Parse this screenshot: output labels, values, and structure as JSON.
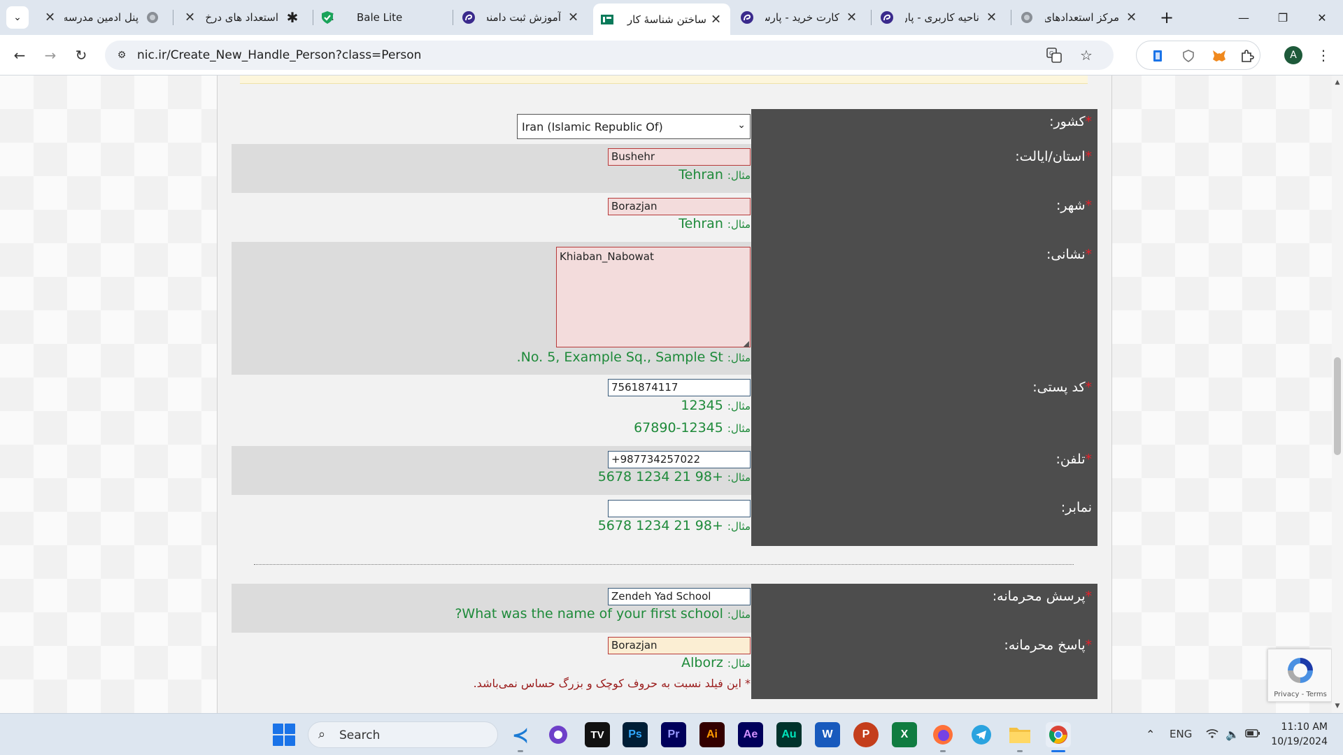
{
  "tabs": [
    {
      "title": "پنل ادمین مدرسه",
      "favicon": "globe-icon"
    },
    {
      "title": "استعداد های درخ",
      "favicon": "asterisk-icon"
    },
    {
      "title": "Bale Lite",
      "favicon": "shield-check-icon"
    },
    {
      "title": "آموزش ثبت دامنه",
      "favicon": "parspack-icon"
    },
    {
      "title": "ساختن شناسهٔ کار",
      "favicon": "irnic-icon"
    },
    {
      "title": "کارت خرید - پارس",
      "favicon": "parspack-icon"
    },
    {
      "title": "ناحیه کاربری - پار",
      "favicon": "parspack-icon"
    },
    {
      "title": "مرکز استعدادهای",
      "favicon": "globe-icon"
    }
  ],
  "active_tab": 4,
  "address_bar": {
    "url": "nic.ir/Create_New_Handle_Person?class=Person"
  },
  "profile_initial": "A",
  "form": {
    "country": {
      "label": "کشور:",
      "value": "Iran (Islamic Republic Of)"
    },
    "province": {
      "label": "استان/ایالت:",
      "value": "Bushehr",
      "example_prefix": "مثال:",
      "example": "Tehran"
    },
    "city": {
      "label": "شهر:",
      "value": "Borazjan",
      "example_prefix": "مثال:",
      "example": "Tehran"
    },
    "address": {
      "label": "نشانی:",
      "value": "Khiaban_Nabowat",
      "example_prefix": "مثال:",
      "example": "No. 5, Example Sq., Sample St."
    },
    "postal_code": {
      "label": "کد پستی:",
      "value": "7561874117",
      "example_prefix": "مثال:",
      "example": "12345",
      "example2": "12345-67890"
    },
    "phone": {
      "label": "تلفن:",
      "value": "+987734257022",
      "example_prefix": "مثال:",
      "example": "+98 21 1234 5678"
    },
    "fax": {
      "label": "نمابر:",
      "value": "",
      "example_prefix": "مثال:",
      "example": "+98 21 1234 5678"
    },
    "security_question": {
      "label": "پرسش محرمانه:",
      "value": "Zendeh Yad School",
      "example_prefix": "مثال:",
      "example": "What was the name of your first school?"
    },
    "security_answer": {
      "label": "پاسخ محرمانه:",
      "value": "Borazjan",
      "example_prefix": "مثال:",
      "example": "Alborz"
    },
    "required_mark": "*",
    "case_note": "* این فیلد نسبت به حروف کوچک و بزرگ حساس نمی‌باشد."
  },
  "recaptcha": {
    "links": "Privacy - Terms"
  },
  "taskbar": {
    "search_label": "Search",
    "apps": [
      "vscode-icon",
      "github-icon",
      "tradingview-icon",
      "photoshop-icon",
      "premiere-icon",
      "illustrator-icon",
      "after-effects-icon",
      "audition-icon",
      "word-icon",
      "powerpoint-icon",
      "excel-icon",
      "firefox-icon",
      "telegram-icon",
      "file-explorer-icon",
      "chrome-icon"
    ],
    "app_labels": {
      "tradingview": "TV",
      "photoshop": "Ps",
      "premiere": "Pr",
      "illustrator": "Ai",
      "after_effects": "Ae",
      "audition": "Au",
      "word": "W",
      "powerpoint": "P",
      "excel": "X"
    },
    "language": "ENG",
    "time": "11:10 AM",
    "date": "10/19/2024"
  },
  "colors": {
    "label_panel": "#4d4d4d",
    "required": "#e8202a",
    "example_text": "#1e8a3a",
    "error_field_bg": "#f3dcdc",
    "accent": "#1a73e8"
  }
}
